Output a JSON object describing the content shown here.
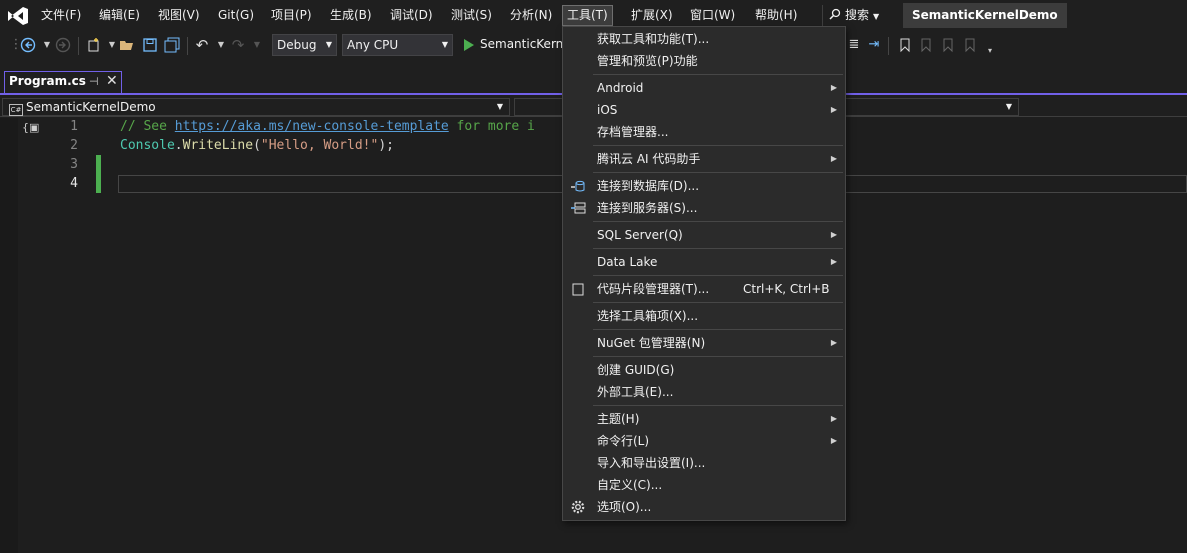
{
  "menubar": {
    "items": [
      "文件(F)",
      "编辑(E)",
      "视图(V)",
      "Git(G)",
      "项目(P)",
      "生成(B)",
      "调试(D)",
      "测试(S)",
      "分析(N)",
      "工具(T)",
      "扩展(X)",
      "窗口(W)",
      "帮助(H)"
    ],
    "search_label": "搜索",
    "solution_name": "SemanticKernelDemo"
  },
  "toolbar": {
    "config": "Debug",
    "platform": "Any CPU",
    "run_label": "SemanticKerne"
  },
  "tab": {
    "name": "Program.cs"
  },
  "navbar": {
    "project": "SemanticKernelDemo"
  },
  "editor": {
    "line_numbers": [
      "1",
      "2",
      "3",
      "4"
    ],
    "line1": {
      "comment_prefix": "// See ",
      "link": "https://aka.ms/new-console-template",
      "comment_suffix": " for more i"
    },
    "line2": {
      "type": "Console",
      "dot": ".",
      "method": "WriteLine",
      "open": "(",
      "string": "\"Hello, World!\"",
      "close": ");"
    }
  },
  "tools_menu": {
    "get_tools": "获取工具和功能(T)...",
    "manage_preview": "管理和预览(P)功能",
    "android": "Android",
    "ios": "iOS",
    "archive_manager": "存档管理器...",
    "tencent_ai": "腾讯云 AI 代码助手",
    "connect_db": "连接到数据库(D)...",
    "connect_server": "连接到服务器(S)...",
    "sql_server": "SQL Server(Q)",
    "data_lake": "Data Lake",
    "snippet_manager": "代码片段管理器(T)...",
    "snippet_shortcut": "Ctrl+K, Ctrl+B",
    "choose_toolbox": "选择工具箱项(X)...",
    "nuget": "NuGet 包管理器(N)",
    "create_guid": "创建 GUID(G)",
    "external_tools": "外部工具(E)...",
    "theme": "主题(H)",
    "command_line": "命令行(L)",
    "import_export": "导入和导出设置(I)...",
    "customize": "自定义(C)...",
    "options": "选项(O)..."
  }
}
